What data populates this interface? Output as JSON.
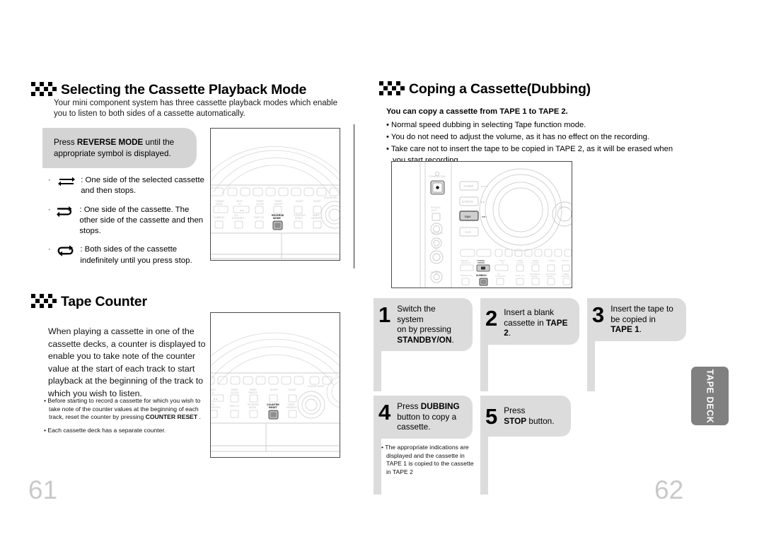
{
  "document": {
    "left_page_number": "61",
    "right_page_number": "62",
    "side_tab_label": "TAPE DECK",
    "accent_gray": "#d4d4d4",
    "tab_gray": "#808080",
    "page_number_color": "#c9c9c9"
  },
  "left": {
    "section1": {
      "title": "Selecting the Cassette Playback Mode",
      "intro": "Your mini component system has three cassette playback modes which enable you to listen to both sides of a cassette automatically.",
      "callout_prefix": "Press ",
      "callout_bold": "REVERSE MODE",
      "callout_suffix": " until the appropriate symbol is displayed.",
      "modes": [
        {
          "symbol": "reverse-once-icon",
          "text": ": One side of the selected cassette and then stops."
        },
        {
          "symbol": "reverse-both-icon",
          "text": ": One side of the cassette. The other side of the cassette and then stops."
        },
        {
          "symbol": "reverse-loop-icon",
          "text": ": Both sides of the cassette indefinitely until you press stop."
        }
      ],
      "device_highlight": "REVERSE MODE"
    },
    "section2": {
      "title": "Tape Counter",
      "paragraph": "When playing a cassette in one of the cassette decks, a counter is displayed to enable you to take note of the counter value at the start of each track to start playback at the beginning of the track to which you wish to listen.",
      "notes": [
        {
          "pre": "• Before starting to record a cassette for which you wish to take note of the counter values at the beginning of each track, reset the counter by pressing ",
          "bold": "COUNTER RESET",
          "post": " ."
        },
        {
          "pre": "• Each cassette deck has a separate counter.",
          "bold": "",
          "post": ""
        }
      ],
      "device_highlight": "COUNTER RESET"
    }
  },
  "right": {
    "section": {
      "title": "Coping a Cassette(Dubbing)",
      "lead": "You can copy a cassette from TAPE 1 to TAPE 2.",
      "bullets": [
        "• Normal speed dubbing in selecting Tape function mode.",
        "• You do not need to adjust the volume, as it has no effect on the recording.",
        "• Take care not to insert the tape to be copied in TAPE 2, as it will be erased when you start recording."
      ],
      "device_highlight": "DUBBING"
    },
    "steps": [
      {
        "number": "1",
        "line1_plain": "Switch the system",
        "line2_plain": "on by pressing",
        "line3_bold": "STANDBY/ON",
        "line3_tail": "."
      },
      {
        "number": "2",
        "line1_plain": "Insert a blank",
        "line2_plain": "cassette in ",
        "line2_bold": "TAPE 2",
        "line2_tail": "."
      },
      {
        "number": "3",
        "line1_plain": "Insert the tape to",
        "line2_plain": "be copied in",
        "line3_bold": "TAPE 1",
        "line3_tail": "."
      },
      {
        "number": "4",
        "line1_plain": "Press ",
        "line1_bold": "DUBBING",
        "line2_plain": "button to copy a",
        "line3_plain": "cassette."
      },
      {
        "number": "5",
        "line1_plain": "Press",
        "line2_bold": "STOP",
        "line2_tail": " button."
      }
    ],
    "step4_note": "• The appropriate indications are displayed and the cassette in TAPE 1 is copied to the cassette  in TAPE 2"
  }
}
